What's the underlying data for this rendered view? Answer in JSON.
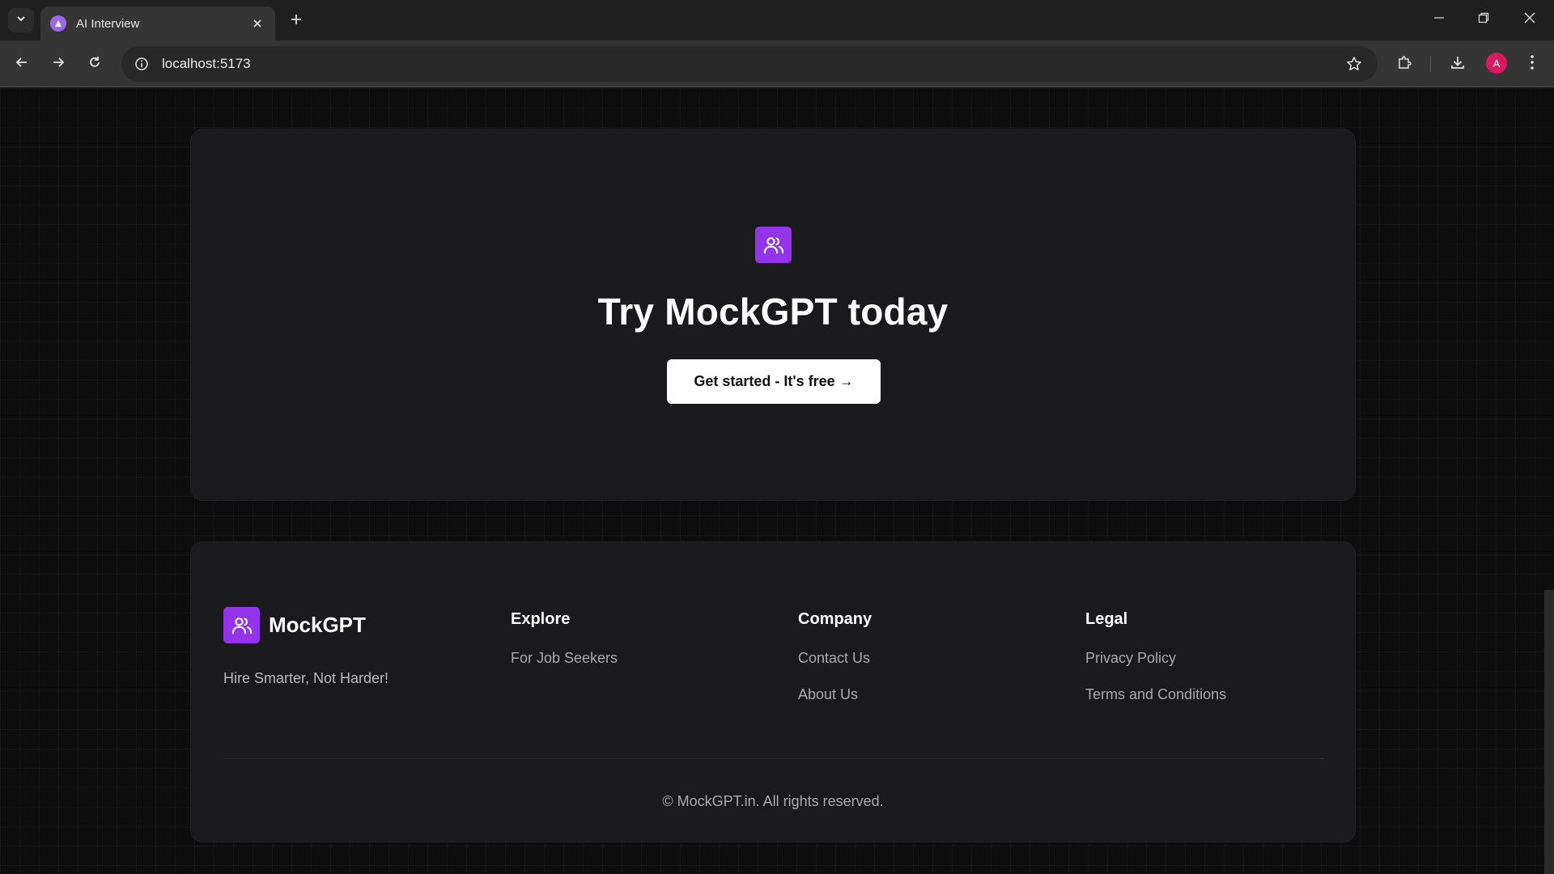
{
  "browser": {
    "tab_title": "AI Interview",
    "url": "localhost:5173",
    "profile_initial": "A"
  },
  "icons": {
    "tab_list": "chevron-down-icon",
    "favicon": "app-favicon-icon",
    "tab_close": "close-icon",
    "new_tab": "plus-icon",
    "minimize": "minimize-icon",
    "restore": "restore-icon",
    "close_window": "close-icon",
    "back": "arrow-left-icon",
    "forward": "arrow-right-icon",
    "reload": "reload-icon",
    "site_info": "info-icon",
    "bookmark": "star-icon",
    "extensions": "puzzle-icon",
    "downloads": "download-icon",
    "menu": "kebab-menu-icon",
    "logo": "users-icon"
  },
  "colors": {
    "accent": "#9333ea",
    "page_bg": "#0d0d0e",
    "card_bg": "#1a1a1c",
    "profile": "#d81b60"
  },
  "cta": {
    "title": "Try MockGPT today",
    "button_label": "Get started - It's free →"
  },
  "footer": {
    "brand_name": "MockGPT",
    "tagline": "Hire Smarter, Not Harder!",
    "columns": [
      {
        "heading": "Explore",
        "links": [
          "For Job Seekers"
        ]
      },
      {
        "heading": "Company",
        "links": [
          "Contact Us",
          "About Us"
        ]
      },
      {
        "heading": "Legal",
        "links": [
          "Privacy Policy",
          "Terms and Conditions"
        ]
      }
    ],
    "copyright": "© MockGPT.in. All rights reserved."
  }
}
